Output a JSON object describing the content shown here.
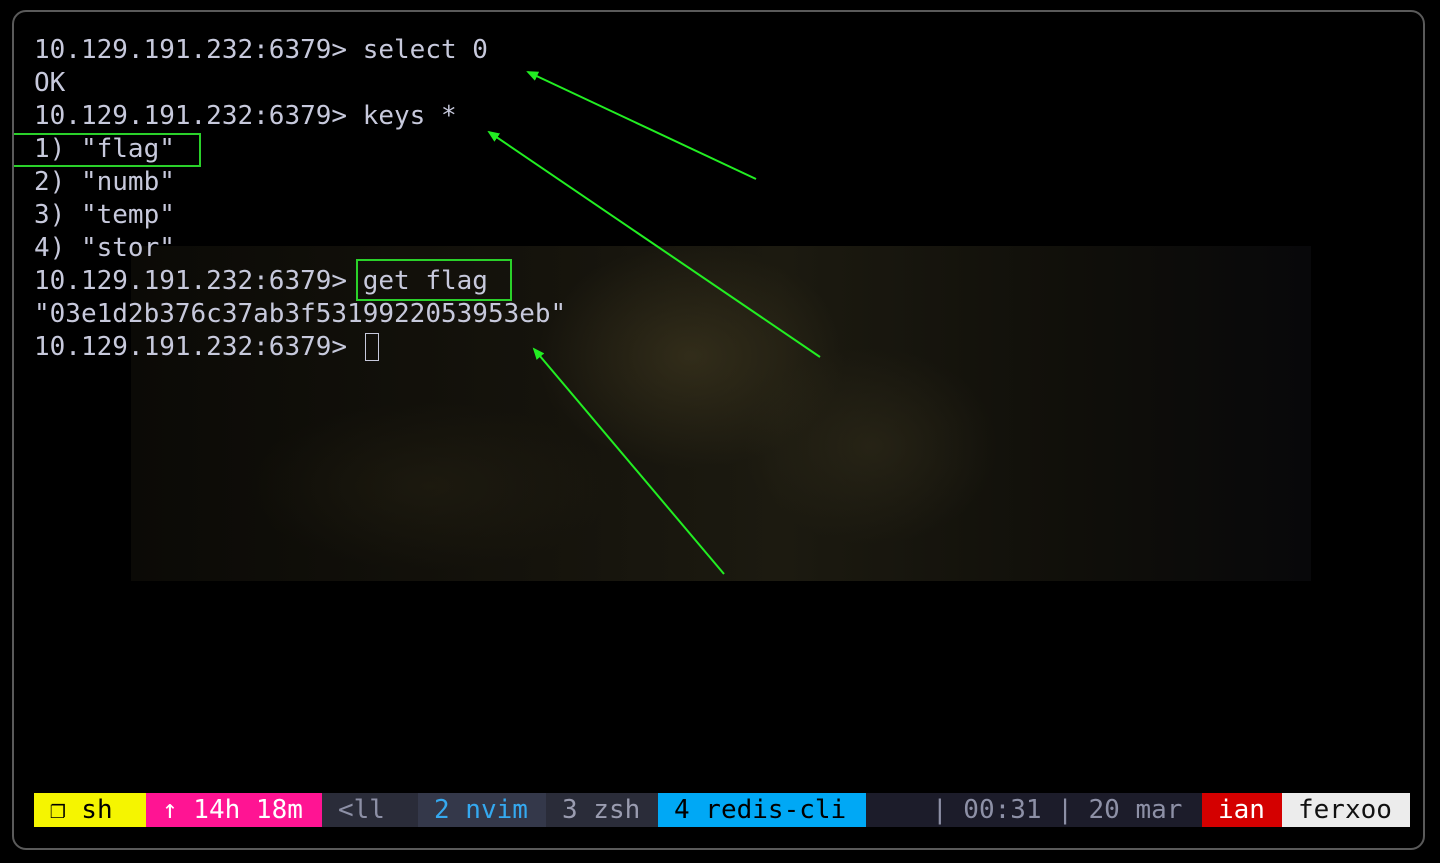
{
  "terminal": {
    "lines": [
      "10.129.191.232:6379> select 0",
      "OK",
      "10.129.191.232:6379> keys *",
      "1) \"flag\"",
      "2) \"numb\"",
      "3) \"temp\"",
      "4) \"stor\"",
      "10.129.191.232:6379> get flag",
      "\"03e1d2b376c37ab3f5319922053953eb\"",
      "10.129.191.232:6379> "
    ]
  },
  "colors": {
    "text": "#c7c9dc",
    "annotation": "#2ad12a",
    "arrow": "#22ee22"
  },
  "statusbar": {
    "session": "❐ sh",
    "uptime": "↑ 14h 18m",
    "prev_window": "<ll",
    "window_2": "2 nvim",
    "window_3": "3 zsh",
    "window_4": "4 redis-cli",
    "clock": "| 00:31 | 20 mar",
    "user": "ian",
    "host": "ferxoo"
  }
}
